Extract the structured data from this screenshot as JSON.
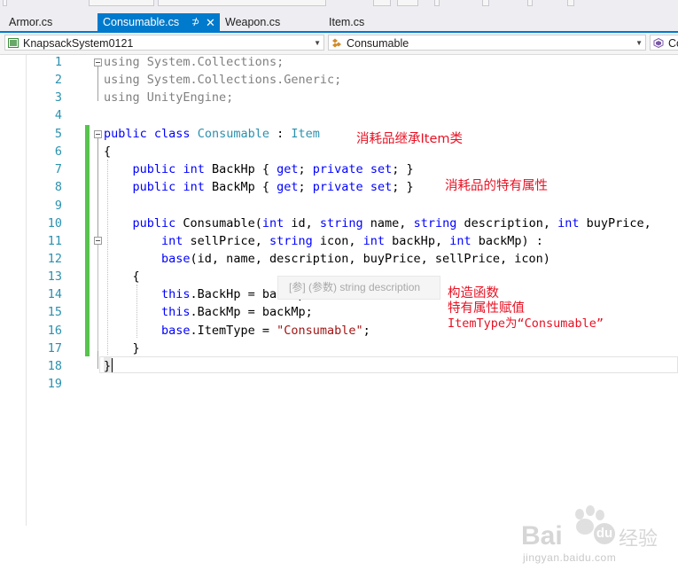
{
  "tabs": [
    {
      "label": "Armor.cs",
      "active": false
    },
    {
      "label": "Consumable.cs",
      "active": true,
      "pin": "⊅",
      "close": "✕"
    },
    {
      "label": "Weapon.cs",
      "active": false
    },
    {
      "label": "Item.cs",
      "active": false
    }
  ],
  "nav": {
    "project": "KnapsackSystem0121",
    "class": "Consumable",
    "member": "Co"
  },
  "editor": {
    "line_numbers": [
      "1",
      "2",
      "3",
      "4",
      "5",
      "6",
      "7",
      "8",
      "9",
      "10",
      "11",
      "12",
      "13",
      "14",
      "15",
      "16",
      "17",
      "18",
      "19"
    ],
    "code": {
      "l1": {
        "kw": "using",
        "rest": " System.Collections;"
      },
      "l2": {
        "kw": "using",
        "rest": " System.Collections.Generic;"
      },
      "l3": {
        "kw": "using",
        "rest": " UnityEngine;"
      },
      "l5": {
        "kw1": "public",
        "kw2": "class",
        "name": "Consumable",
        "colon": " : ",
        "base": "Item"
      },
      "l6": "{",
      "l7": {
        "kw1": "public",
        "kw2": "int",
        "name": " BackHp { ",
        "get": "get",
        "semi1": "; ",
        "priv": "private",
        "set": "set",
        "end": "; }"
      },
      "l8": {
        "kw1": "public",
        "kw2": "int",
        "name": " BackMp { ",
        "get": "get",
        "semi1": "; ",
        "priv": "private",
        "set": "set",
        "end": "; }"
      },
      "l10": {
        "kw1": "public",
        "p1": " Consumable(",
        "k1": "int",
        "p2": " id, ",
        "k2": "string",
        "p3": " name, ",
        "k3": "string",
        "p4": " description, ",
        "k4": "int",
        "p5": " buyPrice,"
      },
      "l11": {
        "k1": "int",
        "p1": " sellPrice, ",
        "k2": "string",
        "p2": " icon, ",
        "k3": "int",
        "p3": " backHp, ",
        "k4": "int",
        "p4": " backMp) :"
      },
      "l12": {
        "kw": "base",
        "rest": "(id, name, description, buyPrice, sellPrice, icon)"
      },
      "l13": "{",
      "l14": {
        "kw": "this",
        "rest": ".BackHp = backHp;"
      },
      "l15": {
        "kw": "this",
        "rest": ".BackMp = backMp;"
      },
      "l16": {
        "kw": "base",
        "mid": ".ItemType = ",
        "str": "\"Consumable\"",
        "end": ";"
      },
      "l17": "}",
      "l18": "}"
    },
    "tooltip": "[参] (参数) string description"
  },
  "annotations": {
    "a1": "消耗品继承Item类",
    "a2": "消耗品的特有属性",
    "a3": "构造函数",
    "a4": "特有属性赋值",
    "a5": "ItemType为“Consumable”"
  },
  "watermark": {
    "brand": "Bai",
    "brand2": "经验",
    "url": "jingyan.baidu.com"
  },
  "colors": {
    "keyword": "#0000ff",
    "type": "#2b91af",
    "string": "#a31515",
    "annotation": "#e81123",
    "tab_active": "#007acc",
    "change_bar": "#57c44d"
  }
}
